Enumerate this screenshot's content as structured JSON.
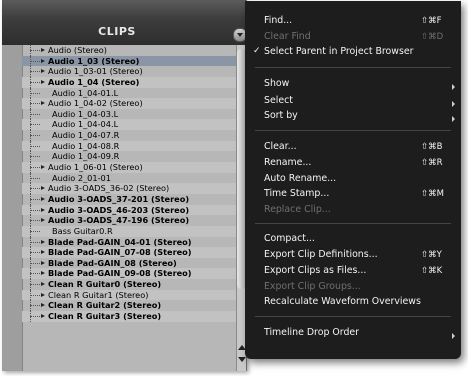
{
  "panel": {
    "title": "CLIPS"
  },
  "clips": [
    {
      "label": "Audio (Stereo)",
      "bold": false,
      "tri": true
    },
    {
      "label": "Audio 1_03 (Stereo)",
      "bold": true,
      "tri": true,
      "selected": true
    },
    {
      "label": "Audio 1_03-01 (Stereo)",
      "bold": false,
      "tri": true
    },
    {
      "label": "Audio 1_04 (Stereo)",
      "bold": true,
      "tri": true
    },
    {
      "label": "Audio 1_04-01.L",
      "bold": false,
      "tri": false
    },
    {
      "label": "Audio 1_04-02 (Stereo)",
      "bold": false,
      "tri": true
    },
    {
      "label": "Audio 1_04-03.L",
      "bold": false,
      "tri": false
    },
    {
      "label": "Audio 1_04-04.L",
      "bold": false,
      "tri": false
    },
    {
      "label": "Audio 1_04-07.R",
      "bold": false,
      "tri": false
    },
    {
      "label": "Audio 1_04-08.R",
      "bold": false,
      "tri": false
    },
    {
      "label": "Audio 1_04-09.R",
      "bold": false,
      "tri": false
    },
    {
      "label": "Audio 1_06-01 (Stereo)",
      "bold": false,
      "tri": true
    },
    {
      "label": "Audio 2_01-01",
      "bold": false,
      "tri": false
    },
    {
      "label": "Audio 3-OADS_36-02 (Stereo)",
      "bold": false,
      "tri": true
    },
    {
      "label": "Audio 3-OADS_37-201 (Stereo)",
      "bold": true,
      "tri": true
    },
    {
      "label": "Audio 3-OADS_46-203 (Stereo)",
      "bold": true,
      "tri": true
    },
    {
      "label": "Audio 3-OADS_47-196 (Stereo)",
      "bold": true,
      "tri": true
    },
    {
      "label": "Bass Guitar0.R",
      "bold": false,
      "tri": false
    },
    {
      "label": "Blade Pad-GAIN_04-01 (Stereo)",
      "bold": true,
      "tri": true
    },
    {
      "label": "Blade Pad-GAIN_07-08 (Stereo)",
      "bold": true,
      "tri": true
    },
    {
      "label": "Blade Pad-GAIN_08 (Stereo)",
      "bold": true,
      "tri": true
    },
    {
      "label": "Blade Pad-GAIN_09-08 (Stereo)",
      "bold": true,
      "tri": true
    },
    {
      "label": "Clean R Guitar0 (Stereo)",
      "bold": true,
      "tri": true
    },
    {
      "label": "Clean R Guitar1 (Stereo)",
      "bold": false,
      "tri": true
    },
    {
      "label": "Clean R Guitar2 (Stereo)",
      "bold": true,
      "tri": true
    },
    {
      "label": "Clean R Guitar3 (Stereo)",
      "bold": true,
      "tri": true
    }
  ],
  "menu": {
    "items": [
      {
        "label": "Find...",
        "shortcut": "⇧⌘F",
        "disabled": false
      },
      {
        "label": "Clear Find",
        "shortcut": "⇧⌘D",
        "disabled": true
      },
      {
        "label": "Select Parent in Project Browser",
        "checked": true,
        "disabled": false
      },
      {
        "label": "Show",
        "submenu": true
      },
      {
        "label": "Select",
        "submenu": true
      },
      {
        "label": "Sort by",
        "submenu": true
      },
      {
        "label": "Clear...",
        "shortcut": "⇧⌘B"
      },
      {
        "label": "Rename...",
        "shortcut": "⇧⌘R"
      },
      {
        "label": "Auto Rename..."
      },
      {
        "label": "Time Stamp...",
        "shortcut": "⇧⌘M"
      },
      {
        "label": "Replace Clip...",
        "disabled": true
      },
      {
        "label": "Compact..."
      },
      {
        "label": "Export Clip Definitions...",
        "shortcut": "⇧⌘Y"
      },
      {
        "label": "Export Clips as Files...",
        "shortcut": "⇧⌘K"
      },
      {
        "label": "Export Clip Groups...",
        "disabled": true
      },
      {
        "label": "Recalculate Waveform Overviews"
      },
      {
        "label": "Timeline Drop Order",
        "submenu": true
      }
    ]
  }
}
